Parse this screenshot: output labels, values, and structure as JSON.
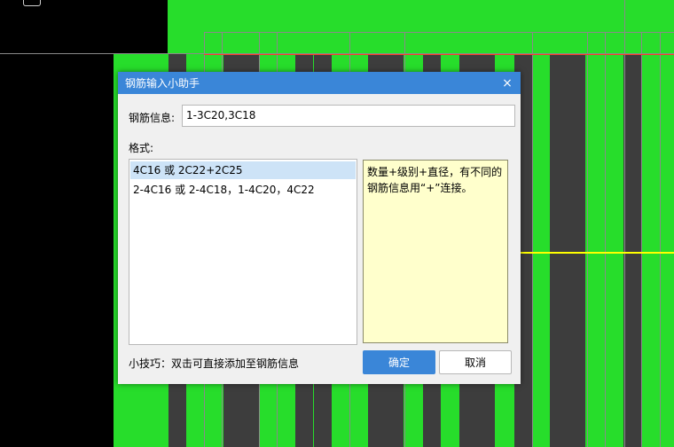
{
  "dialog": {
    "title": "钢筋输入小助手",
    "close_glyph": "×",
    "info_label": "钢筋信息:",
    "info_value": "1-3C20,3C18",
    "format_label": "格式:",
    "format_items": [
      "4C16 或 2C22+2C25",
      "2-4C16 或 2-4C18，1-4C20，4C22"
    ],
    "selected_index": 0,
    "description": "数量+级别+直径，有不同的钢筋信息用“+”连接。",
    "tip": "小技巧：双击可直接添加至钢筋信息",
    "ok_label": "确定",
    "cancel_label": "取消"
  },
  "colors": {
    "cad_green": "#27dd2b",
    "column_gray": "#3d3d3d",
    "title_bar": "#3a86d8",
    "selection": "#cde3f7",
    "hint_yellow": "#ffffcc",
    "axis_yellow": "#ffff00"
  }
}
